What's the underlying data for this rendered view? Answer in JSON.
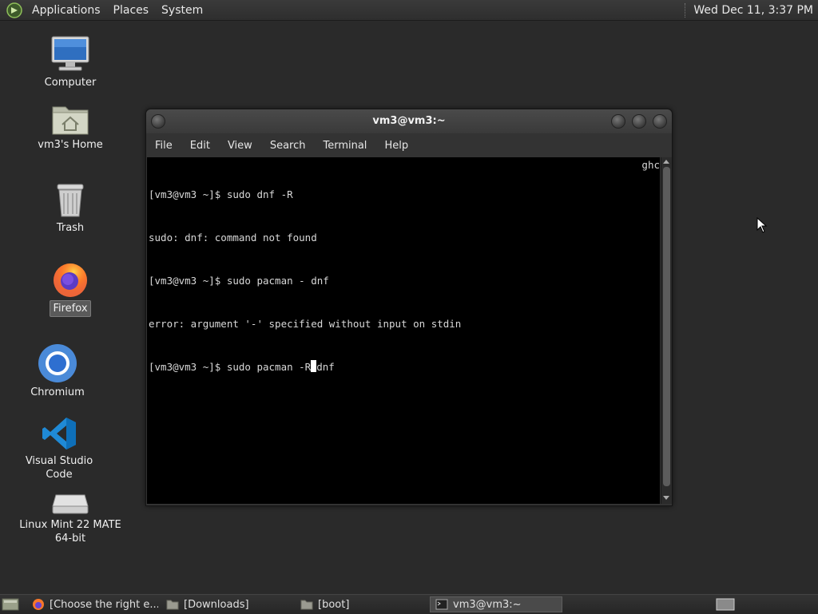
{
  "top_panel": {
    "menus": [
      "Applications",
      "Places",
      "System"
    ],
    "clock": "Wed Dec 11,  3:37 PM"
  },
  "desktop": {
    "icons": [
      {
        "label": "Computer",
        "icon": "computer-icon"
      },
      {
        "label": "vm3's Home",
        "icon": "home-folder-icon"
      },
      {
        "label": "Trash",
        "icon": "trash-icon"
      },
      {
        "label": "Firefox",
        "icon": "firefox-icon"
      },
      {
        "label": "Chromium",
        "icon": "chromium-icon"
      },
      {
        "label": "Visual Studio Code",
        "icon": "vscode-icon"
      },
      {
        "label": "Linux Mint 22 MATE\n64-bit",
        "icon": "drive-icon"
      }
    ]
  },
  "terminal": {
    "title": "vm3@vm3:~",
    "menu": [
      "File",
      "Edit",
      "View",
      "Search",
      "Terminal",
      "Help"
    ],
    "lines": [
      "[vm3@vm3 ~]$ sudo dnf -R",
      "sudo: dnf: command not found",
      "[vm3@vm3 ~]$ sudo pacman - dnf",
      "error: argument '-' specified without input on stdin"
    ],
    "current_line_before_cursor": "[vm3@vm3 ~]$ sudo pacman -R",
    "current_line_after_cursor": "dnf",
    "right_label": "ghc"
  },
  "taskbar": {
    "tasks": [
      {
        "label": "[Choose the right e...",
        "icon": "firefox-icon",
        "active": false
      },
      {
        "label": "[Downloads]",
        "icon": "folder-icon",
        "active": false
      },
      {
        "label": "[boot]",
        "icon": "folder-icon",
        "active": false
      },
      {
        "label": "vm3@vm3:~",
        "icon": "terminal-icon",
        "active": true
      }
    ]
  },
  "colors": {
    "desktop_bg": "#2a2a2a",
    "terminal_bg": "#000000",
    "panel_bg": "#2e2e2e"
  }
}
